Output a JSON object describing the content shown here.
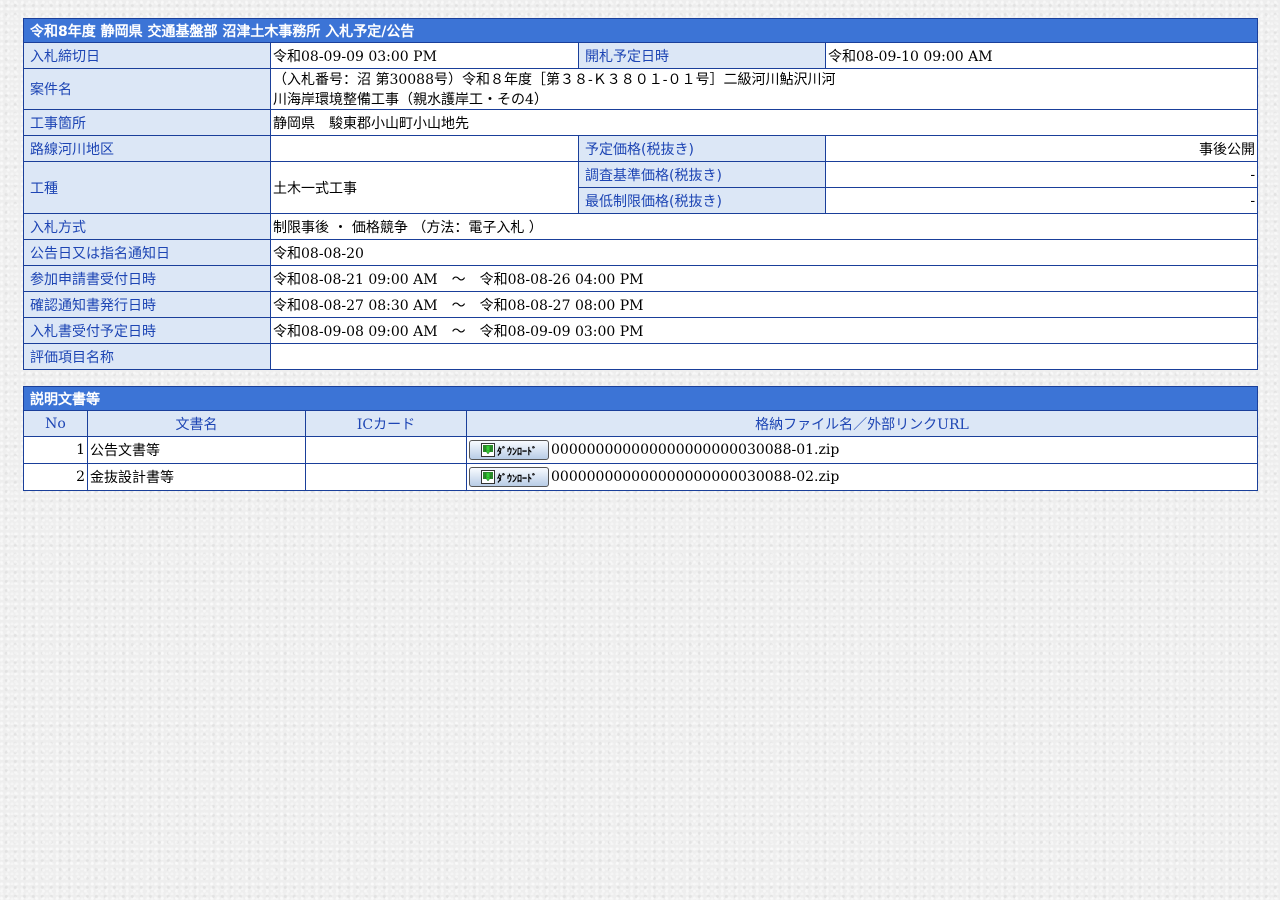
{
  "notice": {
    "title": "令和8年度 静岡県 交通基盤部 沼津土木事務所 入札予定/公告",
    "rows": {
      "deadline": {
        "label": "入札締切日",
        "value": "令和08-09-09 03:00 PM"
      },
      "opening": {
        "label": "開札予定日時",
        "value": "令和08-09-10 09:00 AM"
      },
      "project": {
        "label": "案件名",
        "value_line1": "（入札番号：沼 第30088号）令和８年度［第３８-Ｋ３８０１-０１号］二級河川鮎沢川河",
        "value_line2": "川海岸環境整備工事（親水護岸工・その4）"
      },
      "location": {
        "label": "工事箇所",
        "value": "静岡県　駿東郡小山町小山地先"
      },
      "route": {
        "label": "路線河川地区",
        "value": ""
      },
      "planned_price": {
        "label": "予定価格(税抜き)",
        "value": "事後公開"
      },
      "work_type": {
        "label": "工種",
        "value": "土木一式工事"
      },
      "survey_price": {
        "label": "調査基準価格(税抜き)",
        "value": "-"
      },
      "min_price": {
        "label": "最低制限価格(税抜き)",
        "value": "-"
      },
      "bid_method": {
        "label": "入札方式",
        "value": "制限事後 ・ 価格競争 （方法：電子入札 ）"
      },
      "notice_date": {
        "label": "公告日又は指名通知日",
        "value": "令和08-08-20"
      },
      "application": {
        "label": "参加申請書受付日時",
        "value": "令和08-08-21 09:00 AM　～　令和08-08-26 04:00 PM"
      },
      "confirmation": {
        "label": "確認通知書発行日時",
        "value": "令和08-08-27 08:30 AM　～　令和08-08-27 08:00 PM"
      },
      "bid_reception": {
        "label": "入札書受付予定日時",
        "value": "令和08-09-08 09:00 AM　～　令和08-09-09 03:00 PM"
      },
      "evaluation": {
        "label": "評価項目名称",
        "value": ""
      }
    }
  },
  "documents": {
    "title": "説明文書等",
    "headers": {
      "no": "No",
      "name": "文書名",
      "ic": "ICカード",
      "file": "格納ファイル名／外部リンクURL"
    },
    "download_label": "ﾀﾞｳﾝﾛｰﾄﾞ",
    "download_icon": "download-icon",
    "items": [
      {
        "no": "1",
        "name": "公告文書等",
        "ic": "",
        "file": "000000000000000000000030088-01.zip"
      },
      {
        "no": "2",
        "name": "金抜設計書等",
        "ic": "",
        "file": "000000000000000000000030088-02.zip"
      }
    ]
  },
  "colors": {
    "header_bg": "#3c74d6",
    "label_bg": "#dce7f6",
    "label_text": "#1d45b4",
    "border": "#1a3f9a"
  }
}
